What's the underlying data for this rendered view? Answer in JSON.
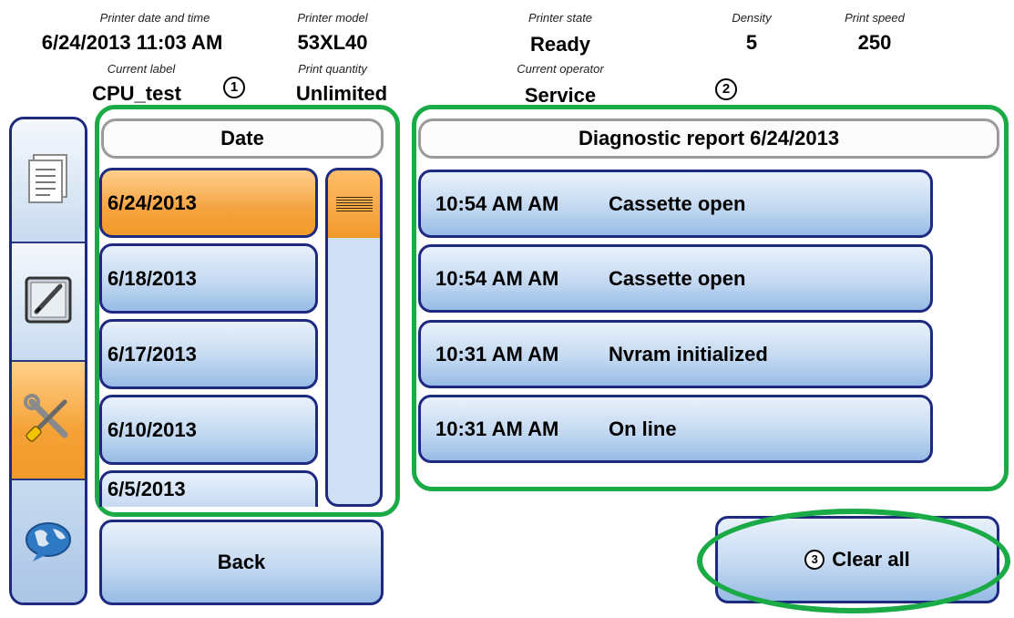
{
  "status": {
    "printer_datetime": {
      "label": "Printer date and time",
      "value": "6/24/2013 11:03 AM"
    },
    "printer_model": {
      "label": "Printer model",
      "value": "53XL40"
    },
    "printer_state": {
      "label": "Printer state",
      "value": "Ready"
    },
    "density": {
      "label": "Density",
      "value": "5"
    },
    "print_speed": {
      "label": "Print speed",
      "value": "250"
    },
    "current_label": {
      "label": "Current label",
      "value": "CPU_test"
    },
    "print_quantity": {
      "label": "Print quantity",
      "value": "Unlimited"
    },
    "current_operator": {
      "label": "Current operator",
      "value": "Service"
    }
  },
  "markers": {
    "one": "1",
    "two": "2",
    "three": "3"
  },
  "nav": {
    "items": [
      {
        "icon": "document-icon",
        "active": false
      },
      {
        "icon": "edit-pen-icon",
        "active": false
      },
      {
        "icon": "tools-icon",
        "active": true
      },
      {
        "icon": "globe-chat-icon",
        "active": false
      }
    ]
  },
  "date_panel": {
    "header": "Date",
    "dates": [
      "6/24/2013",
      "6/18/2013",
      "6/17/2013",
      "6/10/2013",
      "6/5/2013"
    ],
    "selected_index": 0
  },
  "report_panel": {
    "header": "Diagnostic report 6/24/2013",
    "entries": [
      {
        "time": "10:54 AM AM",
        "event": "Cassette open"
      },
      {
        "time": "10:54 AM AM",
        "event": "Cassette open"
      },
      {
        "time": "10:31 AM AM",
        "event": "Nvram initialized"
      },
      {
        "time": "10:31 AM AM",
        "event": "On line"
      }
    ]
  },
  "buttons": {
    "back": "Back",
    "clear_all": "Clear all"
  },
  "colors": {
    "accent_orange": "#f29a2a",
    "button_blue": "#c4d9f1",
    "border_navy": "#1e2a80",
    "annotation_green": "#1aaa46"
  }
}
